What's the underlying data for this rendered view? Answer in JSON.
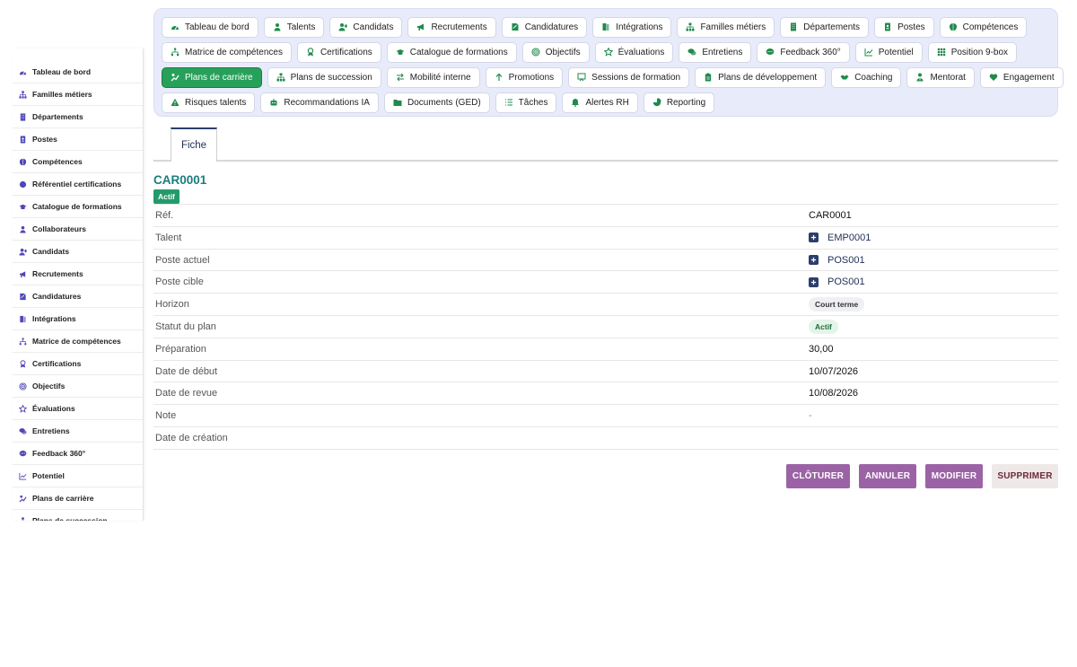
{
  "sidebar": {
    "items": [
      {
        "label": "Tableau de bord",
        "icon": "dashboard-icon"
      },
      {
        "label": "Familles métiers",
        "icon": "sitemap-icon"
      },
      {
        "label": "Départements",
        "icon": "building-icon"
      },
      {
        "label": "Postes",
        "icon": "id-badge-icon"
      },
      {
        "label": "Compétences",
        "icon": "brain-icon"
      },
      {
        "label": "Référentiel certifications",
        "icon": "certificate-icon"
      },
      {
        "label": "Catalogue de formations",
        "icon": "graduation-cap-icon"
      },
      {
        "label": "Collaborateurs",
        "icon": "user-icon"
      },
      {
        "label": "Candidats",
        "icon": "user-plus-icon"
      },
      {
        "label": "Recrutements",
        "icon": "megaphone-icon"
      },
      {
        "label": "Candidatures",
        "icon": "file-signature-icon"
      },
      {
        "label": "Intégrations",
        "icon": "door-open-icon"
      },
      {
        "label": "Matrice de compétences",
        "icon": "matrix-icon"
      },
      {
        "label": "Certifications",
        "icon": "award-icon"
      },
      {
        "label": "Objectifs",
        "icon": "bullseye-icon"
      },
      {
        "label": "Évaluations",
        "icon": "star-icon"
      },
      {
        "label": "Entretiens",
        "icon": "comments-icon"
      },
      {
        "label": "Feedback 360°",
        "icon": "comment-dots-icon"
      },
      {
        "label": "Potentiel",
        "icon": "chart-line-icon"
      },
      {
        "label": "Plans de carrière",
        "icon": "career-icon"
      },
      {
        "label": "Plans de succession",
        "icon": "sitemap-icon"
      }
    ]
  },
  "nav": {
    "rows": [
      [
        {
          "label": "Tableau de bord",
          "icon": "dashboard-icon"
        },
        {
          "label": "Talents",
          "icon": "user-icon"
        },
        {
          "label": "Candidats",
          "icon": "user-plus-icon"
        },
        {
          "label": "Recrutements",
          "icon": "megaphone-icon"
        },
        {
          "label": "Candidatures",
          "icon": "file-signature-icon"
        },
        {
          "label": "Intégrations",
          "icon": "door-open-icon"
        },
        {
          "label": "Familles métiers",
          "icon": "sitemap-icon"
        },
        {
          "label": "Départements",
          "icon": "building-icon"
        },
        {
          "label": "Postes",
          "icon": "id-badge-icon"
        },
        {
          "label": "Compétences",
          "icon": "brain-icon"
        }
      ],
      [
        {
          "label": "Matrice de compétences",
          "icon": "matrix-icon"
        },
        {
          "label": "Certifications",
          "icon": "award-icon"
        },
        {
          "label": "Catalogue de formations",
          "icon": "graduation-cap-icon"
        },
        {
          "label": "Objectifs",
          "icon": "bullseye-icon"
        },
        {
          "label": "Évaluations",
          "icon": "star-icon"
        },
        {
          "label": "Entretiens",
          "icon": "comments-icon"
        },
        {
          "label": "Feedback 360°",
          "icon": "comment-dots-icon"
        },
        {
          "label": "Potentiel",
          "icon": "chart-line-icon"
        },
        {
          "label": "Position 9-box",
          "icon": "grid-icon"
        }
      ],
      [
        {
          "label": "Plans de carrière",
          "icon": "career-icon",
          "active": true
        },
        {
          "label": "Plans de succession",
          "icon": "sitemap-icon"
        },
        {
          "label": "Mobilité interne",
          "icon": "exchange-icon"
        },
        {
          "label": "Promotions",
          "icon": "arrow-up-icon"
        },
        {
          "label": "Sessions de formation",
          "icon": "chalkboard-icon"
        },
        {
          "label": "Plans de développement",
          "icon": "clipboard-icon"
        },
        {
          "label": "Coaching",
          "icon": "handshake-icon"
        },
        {
          "label": "Mentorat",
          "icon": "mentor-icon"
        },
        {
          "label": "Engagement",
          "icon": "heart-icon"
        }
      ],
      [
        {
          "label": "Risques talents",
          "icon": "warning-icon"
        },
        {
          "label": "Recommandations IA",
          "icon": "robot-icon"
        },
        {
          "label": "Documents (GED)",
          "icon": "folder-open-icon"
        },
        {
          "label": "Tâches",
          "icon": "tasks-icon"
        },
        {
          "label": "Alertes RH",
          "icon": "bell-icon"
        },
        {
          "label": "Reporting",
          "icon": "chart-pie-icon"
        }
      ]
    ]
  },
  "tabs": {
    "fiche": "Fiche"
  },
  "record": {
    "id": "CAR0001",
    "status_badge": "Actif",
    "fields": {
      "ref_label": "Réf.",
      "ref_value": "CAR0001",
      "talent_label": "Talent",
      "talent_value": "EMP0001",
      "poste_actuel_label": "Poste actuel",
      "poste_actuel_value": "POS001",
      "poste_cible_label": "Poste cible",
      "poste_cible_value": "POS001",
      "horizon_label": "Horizon",
      "horizon_value": "Court terme",
      "statut_label": "Statut du plan",
      "statut_value": "Actif",
      "preparation_label": "Préparation",
      "preparation_value": "30,00",
      "date_debut_label": "Date de début",
      "date_debut_value": "10/07/2026",
      "date_revue_label": "Date de revue",
      "date_revue_value": "10/08/2026",
      "note_label": "Note",
      "note_value": "-",
      "date_creation_label": "Date de création"
    }
  },
  "actions": {
    "cloturer": "CLÔTURER",
    "annuler": "ANNULER",
    "modifier": "MODIFIER",
    "supprimer": "SUPPRIMER"
  },
  "colors": {
    "accent_teal": "#1c7d7d",
    "active_green": "#27a05a",
    "action_purple": "#9b63a5",
    "icon_purple": "#4f46b8",
    "icon_green": "#1f8a4c"
  }
}
